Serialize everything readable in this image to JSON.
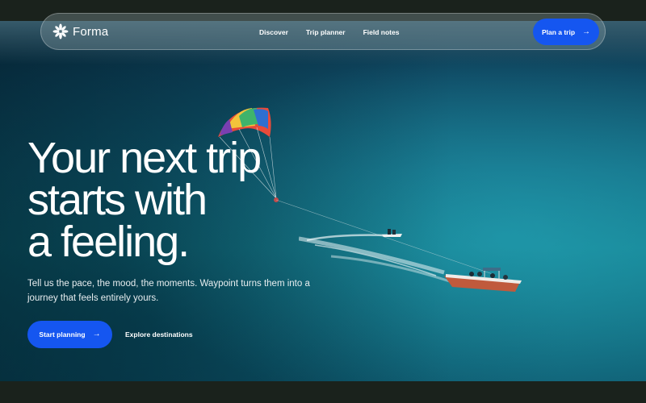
{
  "brand": {
    "name": "Forma",
    "logo_icon": "asterisk-flower-icon"
  },
  "nav": {
    "links": [
      "Discover",
      "Trip planner",
      "Field notes"
    ],
    "cta": {
      "label": "Plan a trip",
      "icon": "arrow-right-icon"
    }
  },
  "hero": {
    "title_lines": [
      "Your next trip",
      "starts with",
      "a feeling."
    ],
    "subtitle": "Tell us the pace, the mood, the moments. Waypoint turns them into a journey that feels entirely yours.",
    "primary_cta": {
      "label": "Start planning",
      "icon": "arrow-right-icon"
    },
    "secondary_cta": {
      "label": "Explore destinations"
    }
  },
  "colors": {
    "accent": "#1556f0",
    "background_dark": "#1a221c",
    "sea": "#136b82",
    "text": "#ffffff"
  }
}
